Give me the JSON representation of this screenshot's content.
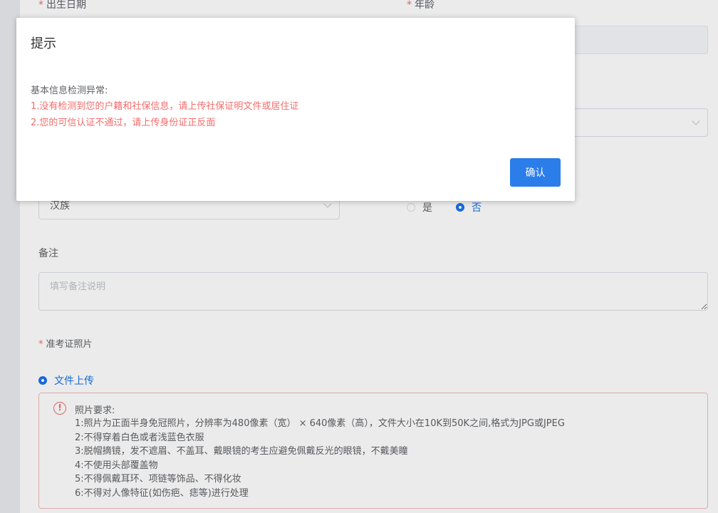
{
  "form": {
    "birth_date_label": "出生日期",
    "age_label": "年龄",
    "ethnicity_value": "汉族",
    "radio_yes": "是",
    "radio_no": "否",
    "remark_label": "备注",
    "remark_placeholder": "填写备注说明",
    "photo_label": "准考证照片",
    "upload_option": "文件上传"
  },
  "photo_requirements": {
    "title": "照片要求:",
    "items": [
      "1:照片为正面半身免冠照片，分辨率为480像素（宽） × 640像素（高），文件大小在10K到50K之间,格式为JPG或JPEG",
      "2:不得穿着白色或者浅蓝色衣服",
      "3:脱帽摘镜，发不遮眉、不盖耳、戴眼镜的考生应避免佩戴反光的眼镜，不戴美瞳",
      "4:不使用头部覆盖物",
      "5:不得佩戴耳环、项链等饰品、不得化妆",
      "6:不得对人像特征(如伤疤、痣等)进行处理"
    ]
  },
  "dialog": {
    "title": "提示",
    "intro": "基本信息检测异常:",
    "messages": [
      "1.没有检测到您的户籍和社保信息，请上传社保证明文件或居住证",
      "2.您的可信认证不通过，请上传身份证正反面"
    ],
    "confirm_label": "确认"
  },
  "colors": {
    "primary": "#2b7de9",
    "danger": "#f56c6c"
  }
}
